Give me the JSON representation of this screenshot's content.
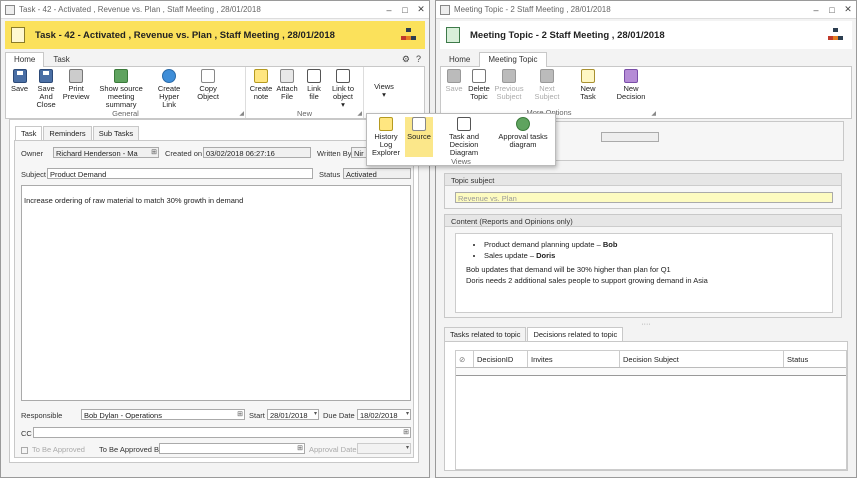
{
  "left": {
    "window_title": "Task - 42 - Activated , Revenue vs. Plan , Staff Meeting , 28/01/2018",
    "header_title": "Task - 42 - Activated , Revenue vs. Plan , Staff Meeting , 28/01/2018",
    "ribbon_tabs": [
      "Home",
      "Task"
    ],
    "groups": {
      "general": {
        "label": "General",
        "buttons": [
          "Save",
          "Save And Close",
          "Print Preview",
          "Show source meeting summary",
          "Create Hyper Link",
          "Copy Object"
        ]
      },
      "new": {
        "label": "New",
        "buttons": [
          "Create note",
          "Attach File",
          "Link file",
          "Link to object"
        ]
      },
      "views_label": "Views"
    },
    "form_tabs": [
      "Task",
      "Reminders",
      "Sub Tasks"
    ],
    "form": {
      "owner_label": "Owner",
      "owner_value": "Richard Henderson - Ma",
      "created_on_label": "Created on",
      "created_on_value": "03/02/2018 06:27:16",
      "written_by_label": "Written By",
      "written_by_value": "Nir L",
      "subject_label": "Subject",
      "subject_value": "Product Demand",
      "status_label": "Status",
      "status_value": "Activated",
      "body_text": "Increase ordering of raw material to match 30% growth in demand",
      "responsible_label": "Responsible",
      "responsible_value": "Bob Dylan - Operations",
      "start_label": "Start",
      "start_value": "28/01/2018",
      "due_date_label": "Due Date",
      "due_date_value": "18/02/2018",
      "cc_label": "CC",
      "to_be_approved_label": "To Be Approved",
      "to_be_approved_by_label": "To Be Approved By",
      "approval_date_label": "Approval Date"
    }
  },
  "views_popup": {
    "label": "Views",
    "buttons": [
      "History Log Explorer",
      "Source",
      "Task and Decision Diagram",
      "Approval tasks diagram"
    ]
  },
  "right": {
    "window_title": "Meeting Topic - 2 Staff Meeting , 28/01/2018",
    "header_title": "Meeting Topic - 2 Staff Meeting , 28/01/2018",
    "ribbon_tabs": [
      "Home",
      "Meeting Topic"
    ],
    "more_options_label": "More Options",
    "buttons": [
      "Save",
      "Delete Topic",
      "Previous Subject",
      "Next Subject",
      "New Task",
      "New Decision"
    ],
    "topic_subject_label": "Topic subject",
    "topic_subject_value": "Revenue vs. Plan",
    "content_label": "Content (Reports and Opinions only)",
    "content": {
      "bullets": [
        {
          "text": "Product demand planning update – ",
          "bold": "Bob"
        },
        {
          "text": "Sales update – ",
          "bold": "Doris"
        }
      ],
      "lines": [
        "Bob updates that demand will be 30% higher than plan for Q1",
        "Doris needs 2 additional sales people to support growing demand in Asia"
      ]
    },
    "bottom_tabs": [
      "Tasks related to topic",
      "Decisions related to topic"
    ],
    "grid_columns": [
      "DecisionID",
      "Invites",
      "Decision Subject",
      "Status"
    ]
  },
  "icons": {
    "window": "window-icon",
    "settings": "gear-icon",
    "help": "help-icon",
    "org": "org-chart-icon",
    "attachment": "paperclip-icon"
  }
}
